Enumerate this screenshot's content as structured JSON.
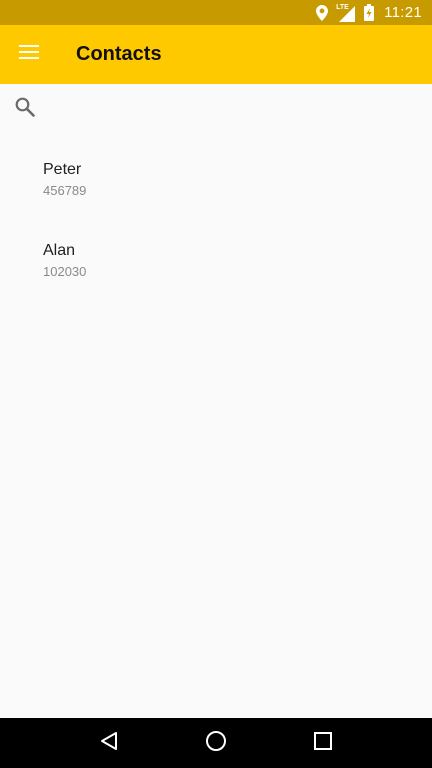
{
  "status_bar": {
    "time": "11:21",
    "network_label": "LTE",
    "icons": [
      "location-icon",
      "lte-signal-icon",
      "battery-charging-icon"
    ]
  },
  "app_bar": {
    "title": "Contacts",
    "menu_icon": "hamburger-menu-icon",
    "background_color": "#ffc900"
  },
  "search": {
    "icon": "search-icon",
    "value": "",
    "placeholder": ""
  },
  "contacts": [
    {
      "name": "Peter",
      "number": "456789"
    },
    {
      "name": "Alan",
      "number": "102030"
    }
  ],
  "nav_bar": {
    "icons": [
      "back-icon",
      "home-icon",
      "recents-icon"
    ]
  },
  "colors": {
    "status_bar": "#c79a00",
    "accent": "#ffc900",
    "background": "#fafafa"
  }
}
